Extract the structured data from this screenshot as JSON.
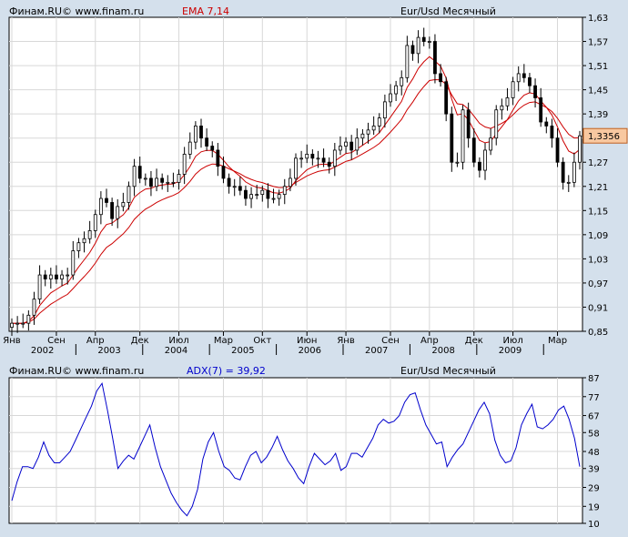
{
  "header": {
    "source_top": "Финам.RU©  www.finam.ru",
    "indicator_top": "EMA 7,14",
    "symbol_top": "Eur/Usd Месячный",
    "source_bottom": "Финам.RU©  www.finam.ru",
    "indicator_bottom": "ADX(7) = 39,92",
    "symbol_bottom": "Eur/Usd Месячный"
  },
  "colors": {
    "background": "#d4e0ec",
    "plot": "#ffffff",
    "grid": "#d8d8d8",
    "candle_up": "#ffffff",
    "candle_down": "#000000",
    "ema": "#cc0000",
    "adx": "#0000cc",
    "last_price_box": "#f8c8a0"
  },
  "chart_data": [
    {
      "type": "candlestick",
      "indicator": "EMA 7,14",
      "y_ticks": [
        "1,63",
        "1,57",
        "1,51",
        "1,45",
        "1,39",
        "1,33",
        "1,27",
        "1,21",
        "1,15",
        "1,09",
        "1,03",
        "0,97",
        "0,91",
        "0,85"
      ],
      "ylim": [
        0.85,
        1.63
      ],
      "last_price": "1,3356",
      "x_month_labels": [
        {
          "i": 0,
          "label": "Янв"
        },
        {
          "i": 8,
          "label": "Сен"
        },
        {
          "i": 15,
          "label": "Апр"
        },
        {
          "i": 23,
          "label": "Дек"
        },
        {
          "i": 30,
          "label": "Июл"
        },
        {
          "i": 38,
          "label": "Мар"
        },
        {
          "i": 45,
          "label": "Окт"
        },
        {
          "i": 53,
          "label": "Июн"
        },
        {
          "i": 60,
          "label": "Янв"
        },
        {
          "i": 68,
          "label": "Сен"
        },
        {
          "i": 75,
          "label": "Апр"
        },
        {
          "i": 83,
          "label": "Дек"
        },
        {
          "i": 90,
          "label": "Июл"
        },
        {
          "i": 98,
          "label": "Мар"
        }
      ],
      "x_year_labels": [
        {
          "i": 5.5,
          "label": "2002"
        },
        {
          "i": 17.5,
          "label": "2003"
        },
        {
          "i": 29.5,
          "label": "2004"
        },
        {
          "i": 41.5,
          "label": "2005"
        },
        {
          "i": 53.5,
          "label": "2006"
        },
        {
          "i": 65.5,
          "label": "2007"
        },
        {
          "i": 77.5,
          "label": "2008"
        },
        {
          "i": 89.5,
          "label": "2009"
        }
      ],
      "closes": [
        0.87,
        0.87,
        0.87,
        0.89,
        0.93,
        0.99,
        0.98,
        0.99,
        0.98,
        0.99,
        0.99,
        1.05,
        1.07,
        1.08,
        1.1,
        1.14,
        1.18,
        1.17,
        1.13,
        1.16,
        1.17,
        1.21,
        1.26,
        1.23,
        1.23,
        1.21,
        1.23,
        1.22,
        1.22,
        1.22,
        1.24,
        1.29,
        1.32,
        1.36,
        1.33,
        1.31,
        1.3,
        1.26,
        1.23,
        1.21,
        1.21,
        1.2,
        1.18,
        1.19,
        1.19,
        1.2,
        1.18,
        1.18,
        1.19,
        1.21,
        1.23,
        1.28,
        1.28,
        1.29,
        1.28,
        1.28,
        1.27,
        1.26,
        1.3,
        1.31,
        1.32,
        1.3,
        1.33,
        1.34,
        1.35,
        1.36,
        1.38,
        1.42,
        1.44,
        1.46,
        1.48,
        1.56,
        1.54,
        1.58,
        1.57,
        1.57,
        1.49,
        1.47,
        1.39,
        1.27,
        1.27,
        1.4,
        1.33,
        1.27,
        1.25,
        1.3,
        1.33,
        1.4,
        1.41,
        1.43,
        1.47,
        1.49,
        1.48,
        1.46,
        1.43,
        1.37,
        1.36,
        1.33,
        1.27,
        1.22,
        1.22,
        1.27,
        1.3356
      ],
      "candles_note": "monthly OHLC, 2002-01 to 2010-07"
    },
    {
      "type": "line",
      "indicator": "ADX(7)",
      "value_label": "39,92",
      "y_ticks": [
        "87",
        "77",
        "67",
        "58",
        "48",
        "39",
        "29",
        "19",
        "10"
      ],
      "ylim": [
        10,
        87
      ],
      "values": [
        22,
        32,
        40,
        40,
        39,
        45,
        53,
        46,
        42,
        42,
        45,
        48,
        54,
        60,
        66,
        72,
        80,
        84,
        70,
        55,
        39,
        43,
        46,
        44,
        50,
        56,
        62,
        50,
        40,
        33,
        26,
        21,
        17,
        14,
        19,
        28,
        44,
        53,
        58,
        48,
        40,
        38,
        34,
        33,
        40,
        46,
        48,
        42,
        45,
        50,
        56,
        49,
        43,
        39,
        34,
        31,
        40,
        47,
        44,
        41,
        43,
        47,
        38,
        40,
        47,
        47,
        45,
        50,
        55,
        62,
        65,
        63,
        64,
        67,
        74,
        78,
        79,
        70,
        62,
        57,
        52,
        53,
        40,
        45,
        49,
        52,
        58,
        64,
        70,
        74,
        68,
        54,
        46,
        42,
        43,
        50,
        62,
        68,
        73,
        61,
        60,
        62,
        65,
        70,
        72,
        65,
        55,
        40
      ]
    }
  ]
}
